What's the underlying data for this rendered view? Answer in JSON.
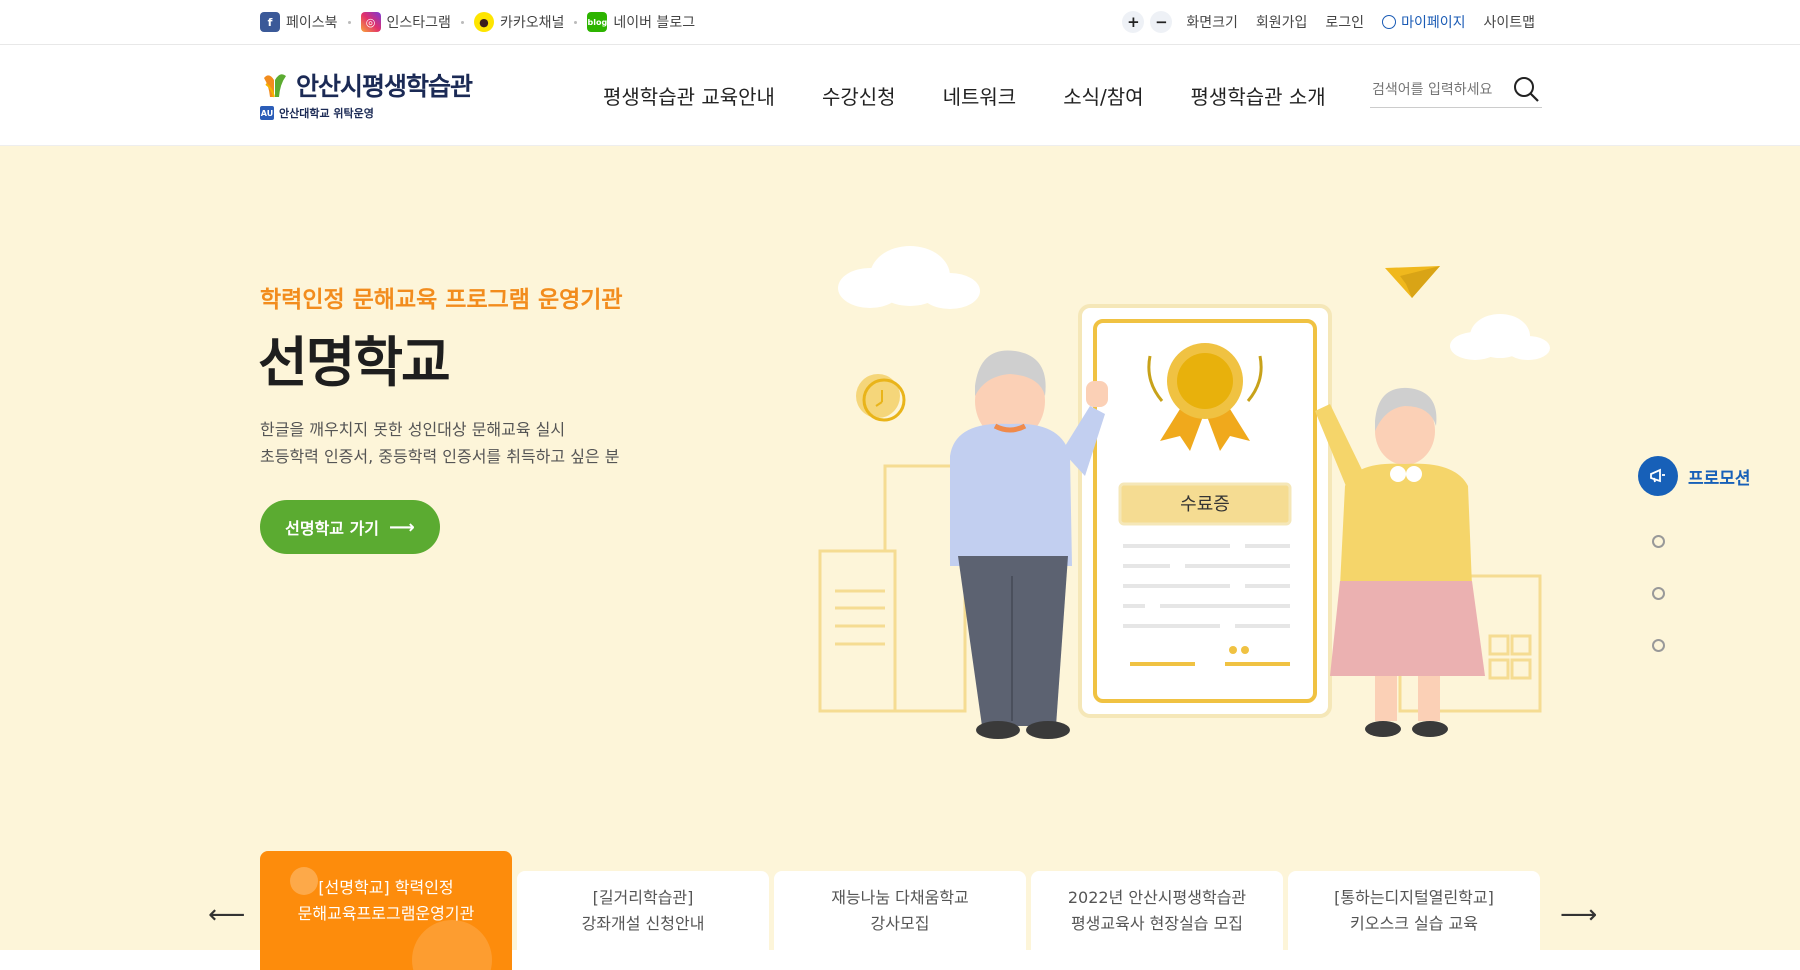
{
  "social": [
    {
      "label": "페이스북",
      "icon": "facebook-icon"
    },
    {
      "label": "인스타그램",
      "icon": "instagram-icon"
    },
    {
      "label": "카카오채널",
      "icon": "kakao-channel-icon"
    },
    {
      "label": "네이버 블로그",
      "icon": "naver-blog-icon"
    }
  ],
  "utility": {
    "zoom_in": "+",
    "zoom_out": "−",
    "screen_size": "화면크기",
    "join": "회원가입",
    "login": "로그인",
    "mypage": "마이페이지",
    "sitemap": "사이트맵"
  },
  "logo": {
    "title": "안산시평생학습관",
    "sub": "안산대학교 위탁운영",
    "mini": "AU"
  },
  "gnb": [
    "평생학습관 교육안내",
    "수강신청",
    "네트워크",
    "소식/참여",
    "평생학습관 소개"
  ],
  "search": {
    "placeholder": "검색어를 입력하세요"
  },
  "hero": {
    "subtitle": "학력인정 문해교육 프로그램 운영기관",
    "title": "선명학교",
    "desc_line1": "한글을 깨우치지 못한 성인대상 문해교육 실시",
    "desc_line2": "초등학력 인증서, 중등학력 인증서를 취득하고 싶은 분",
    "button": "선명학교 가기",
    "certificate_label": "수료증"
  },
  "side_nav": {
    "promo_label": "프로모션"
  },
  "tabs": [
    {
      "label": "[선명학교] 학력인정\n문해교육프로그램운영기관",
      "active": true
    },
    {
      "label": "[길거리학습관]\n강좌개설 신청안내",
      "active": false
    },
    {
      "label": "재능나눔 다채움학교\n강사모집",
      "active": false
    },
    {
      "label": "2022년 안산시평생학습관\n평생교육사 현장실습 모집",
      "active": false
    },
    {
      "label": "[통하는디지털열린학교]\n키오스크 실습 교육",
      "active": false
    }
  ],
  "colors": {
    "accent_orange": "#f28c1d",
    "tab_active": "#fd8c0c",
    "button_green": "#5bab31",
    "promo_blue": "#1760b8",
    "hero_bg": "#fdf5d9"
  }
}
